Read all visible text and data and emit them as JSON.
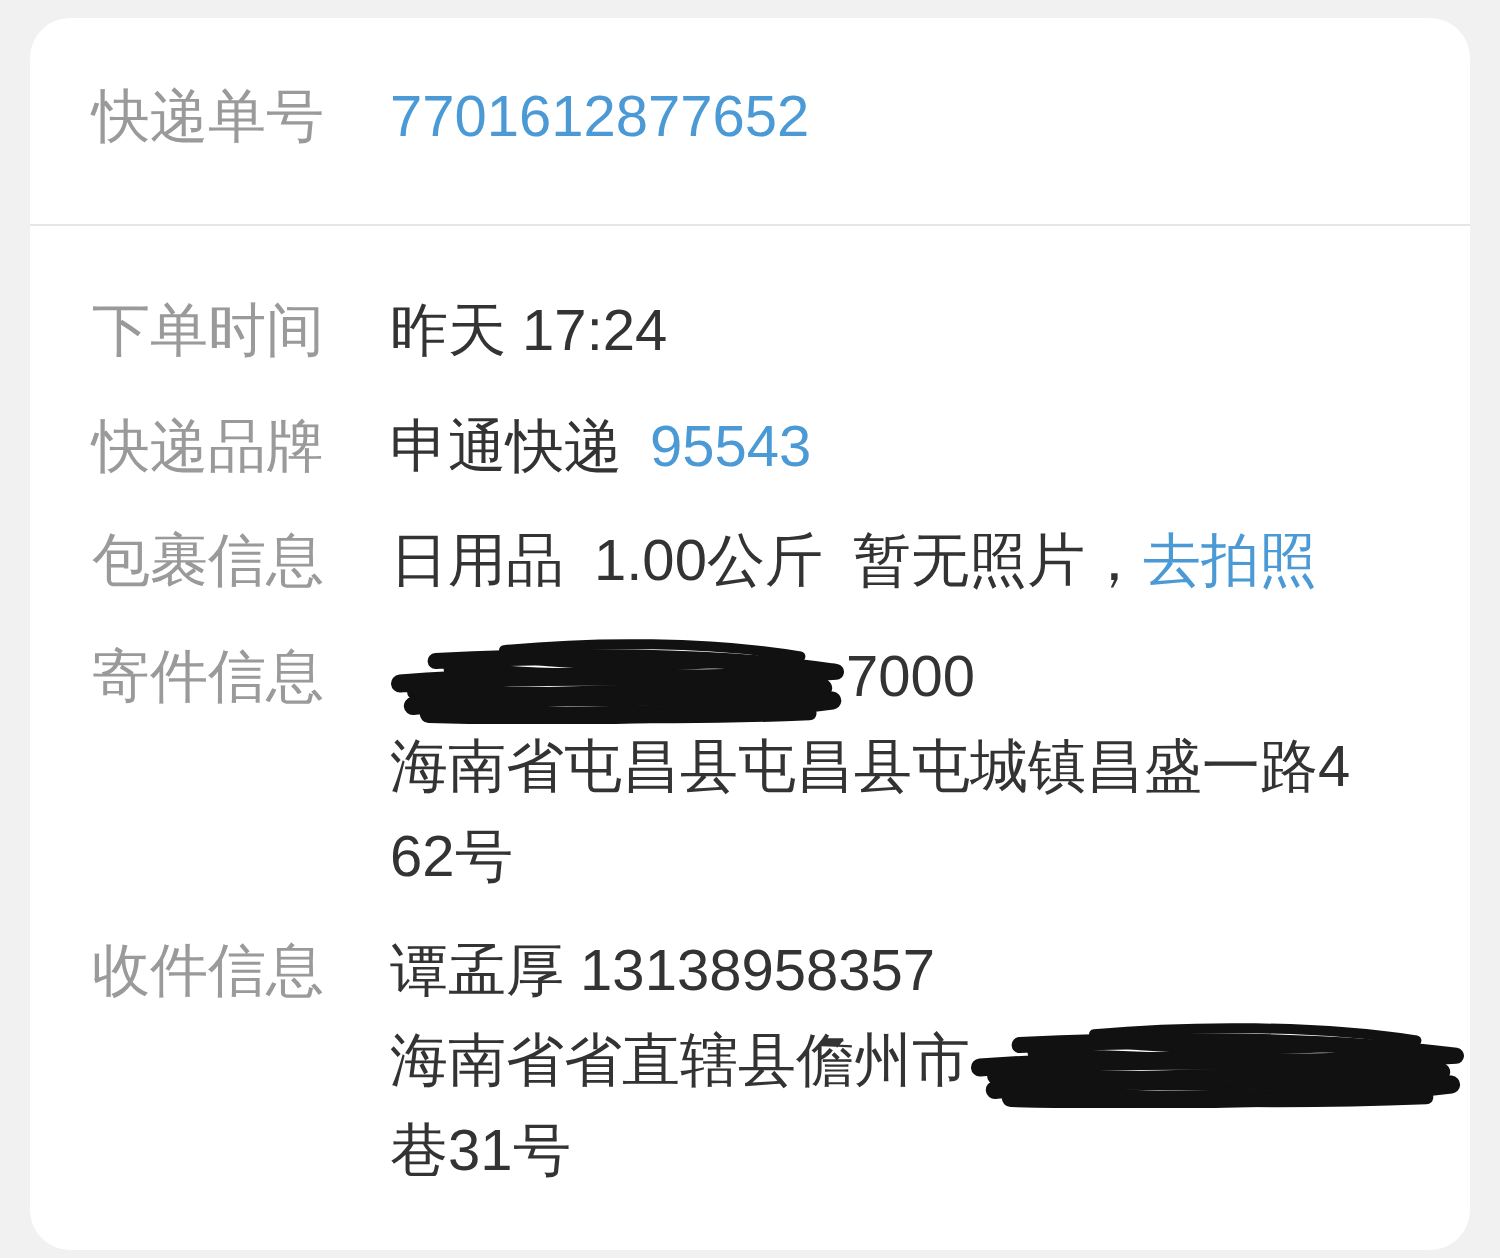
{
  "tracking": {
    "label": "快递单号",
    "number": "7701612877652"
  },
  "details": [
    {
      "kind": "text",
      "label": "下单时间",
      "value": "昨天 17:24"
    },
    {
      "kind": "brand",
      "label": "快递品牌",
      "value": "申通快递",
      "phone": "95543"
    },
    {
      "kind": "package",
      "label": "包裹信息",
      "items": [
        "日用品",
        "1.00公斤",
        "暂无照片，"
      ],
      "link": "去拍照"
    },
    {
      "kind": "address",
      "label": "寄件信息",
      "lines": [
        {
          "kind": "scribble_before",
          "text": "7000"
        },
        {
          "kind": "plain",
          "text": "海南省屯昌县屯昌县屯城镇昌盛一路4"
        },
        {
          "kind": "plain",
          "text": "62号"
        }
      ]
    },
    {
      "kind": "address",
      "label": "收件信息",
      "lines": [
        {
          "kind": "plain",
          "text": "谭孟厚 13138958357"
        },
        {
          "kind": "scribble_after",
          "text": "海南省省直辖县儋州市"
        },
        {
          "kind": "plain",
          "text": "巷31号"
        }
      ]
    }
  ]
}
